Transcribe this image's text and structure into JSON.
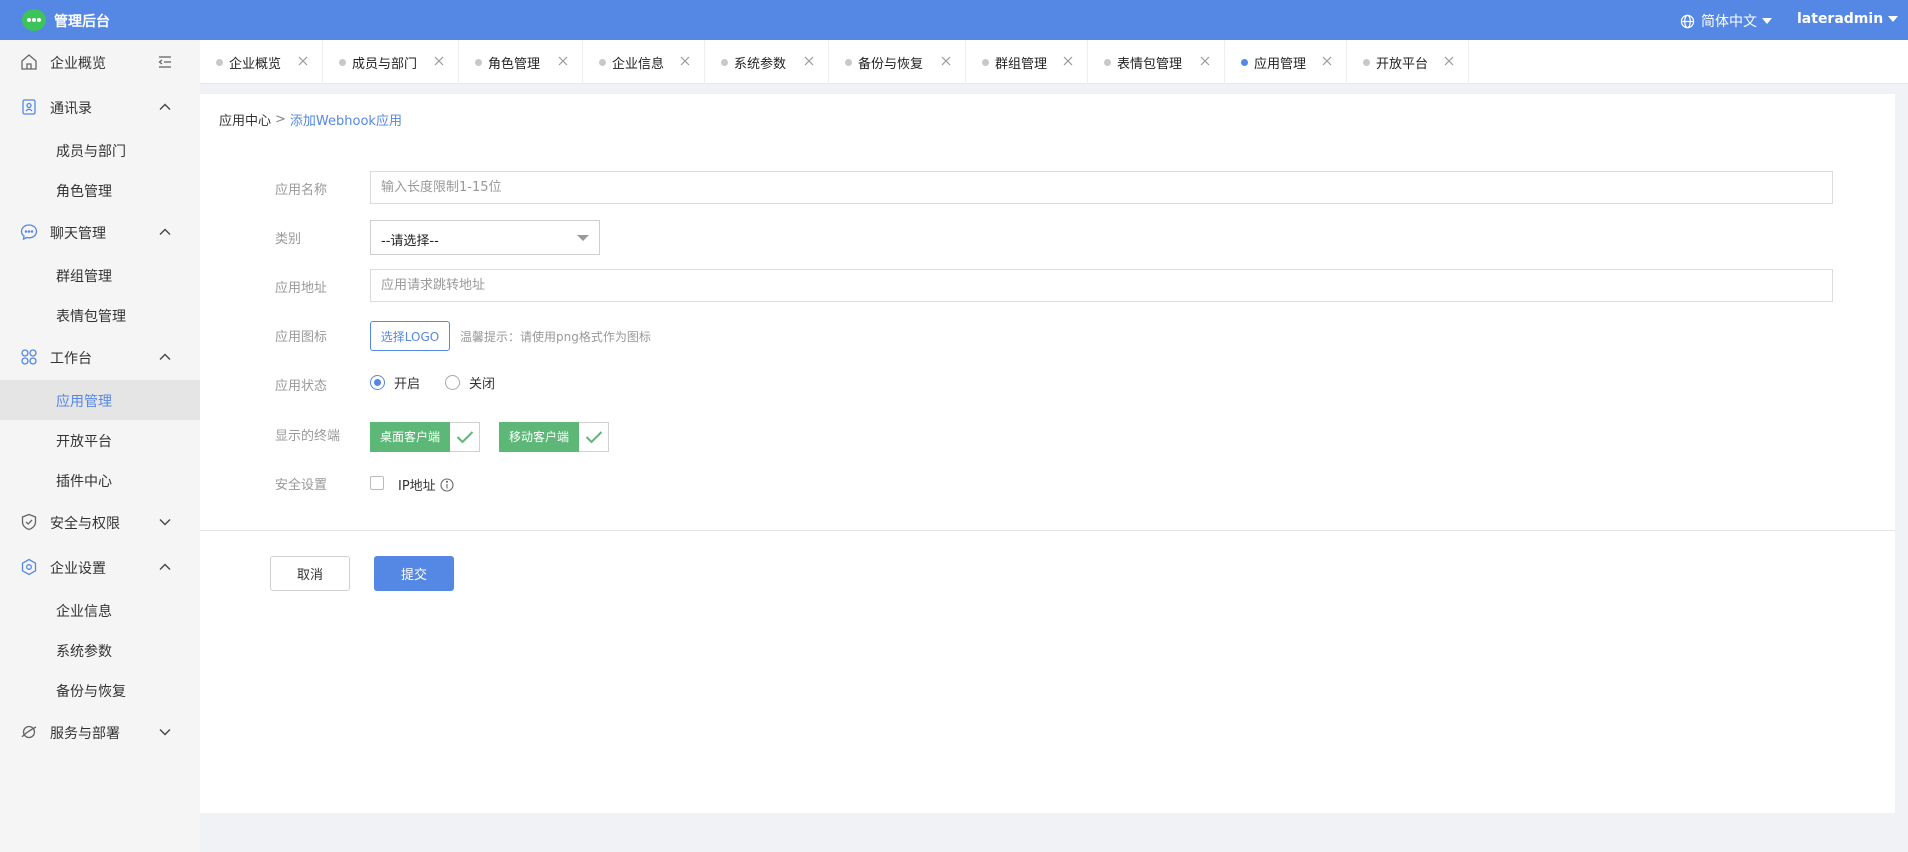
{
  "header": {
    "app_title": "管理后台",
    "language": "简体中文",
    "username": "lateradmin"
  },
  "sidebar": {
    "overview": "企业概览",
    "contacts": {
      "label": "通讯录",
      "items": [
        "成员与部门",
        "角色管理"
      ]
    },
    "chat": {
      "label": "聊天管理",
      "items": [
        "群组管理",
        "表情包管理"
      ]
    },
    "workbench": {
      "label": "工作台",
      "items": [
        "应用管理",
        "开放平台",
        "插件中心"
      ]
    },
    "security": {
      "label": "安全与权限"
    },
    "settings": {
      "label": "企业设置",
      "items": [
        "企业信息",
        "系统参数",
        "备份与恢复"
      ]
    },
    "service": {
      "label": "服务与部署"
    }
  },
  "tabs": [
    "企业概览",
    "成员与部门",
    "角色管理",
    "企业信息",
    "系统参数",
    "备份与恢复",
    "群组管理",
    "表情包管理",
    "应用管理",
    "开放平台"
  ],
  "active_tab": "应用管理",
  "breadcrumb": {
    "parent": "应用中心",
    "separator": ">",
    "current": "添加Webhook应用"
  },
  "form": {
    "name": {
      "label": "应用名称",
      "placeholder": "输入长度限制1-15位"
    },
    "category": {
      "label": "类别",
      "selected": "--请选择--"
    },
    "url": {
      "label": "应用地址",
      "placeholder": "应用请求跳转地址"
    },
    "icon": {
      "label": "应用图标",
      "button": "选择LOGO",
      "hint": "温馨提示：请使用png格式作为图标"
    },
    "status": {
      "label": "应用状态",
      "on": "开启",
      "off": "关闭",
      "selected": "开启"
    },
    "terminals": {
      "label": "显示的终端",
      "desktop": "桌面客户端",
      "mobile": "移动客户端"
    },
    "security": {
      "label": "安全设置",
      "ip": "IP地址"
    }
  },
  "actions": {
    "cancel": "取消",
    "submit": "提交"
  },
  "colors": {
    "primary": "#5587e4",
    "success": "#5db878",
    "logo": "#3cc45a"
  }
}
